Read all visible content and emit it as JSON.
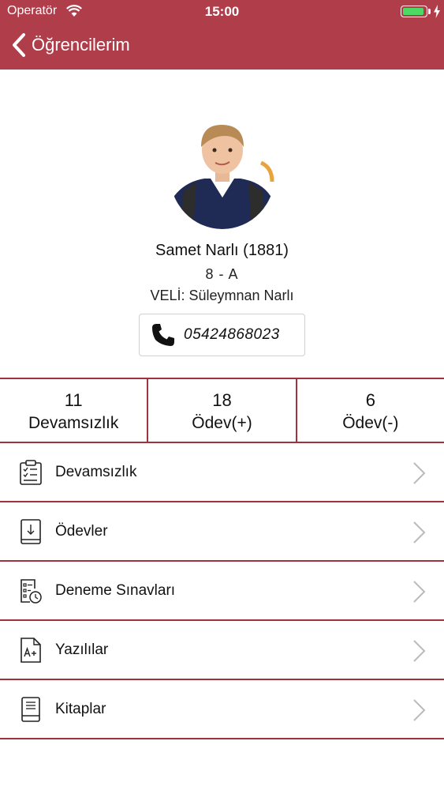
{
  "status_bar": {
    "carrier": "Operatör",
    "time": "15:00"
  },
  "nav": {
    "back_label": "Öğrencilerim"
  },
  "student": {
    "name": "Samet Narlı (1881)",
    "class": "8 - A",
    "parent": "VELİ: Süleymnan Narlı",
    "phone": "05424868023"
  },
  "stats": [
    {
      "value": "11",
      "label": "Devamsızlık"
    },
    {
      "value": "18",
      "label": "Ödev(+)"
    },
    {
      "value": "6",
      "label": "Ödev(-)"
    }
  ],
  "menu": [
    {
      "label": "Devamsızlık",
      "icon": "clipboard-check-icon"
    },
    {
      "label": "Ödevler",
      "icon": "homework-book-icon"
    },
    {
      "label": "Deneme Sınavları",
      "icon": "exam-timer-icon"
    },
    {
      "label": "Yazılılar",
      "icon": "graded-document-icon"
    },
    {
      "label": "Kitaplar",
      "icon": "book-icon"
    }
  ],
  "colors": {
    "brand": "#b03e4a",
    "divider": "#a3303d",
    "battery": "#4cd964"
  }
}
